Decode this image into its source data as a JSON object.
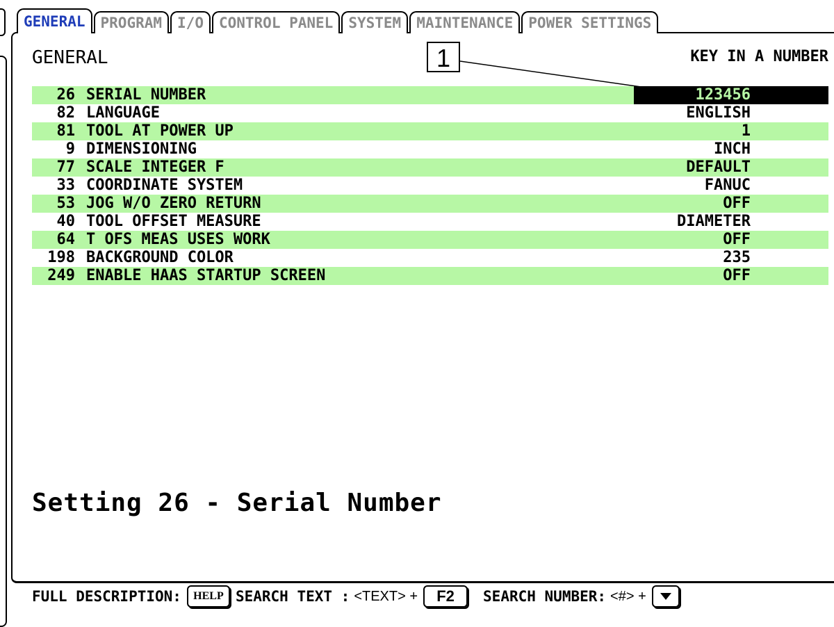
{
  "tabs": [
    {
      "label": "GENERAL",
      "active": true
    },
    {
      "label": "PROGRAM",
      "active": false
    },
    {
      "label": "I/O",
      "active": false
    },
    {
      "label": "CONTROL PANEL",
      "active": false
    },
    {
      "label": "SYSTEM",
      "active": false
    },
    {
      "label": "MAINTENANCE",
      "active": false
    },
    {
      "label": "POWER SETTINGS",
      "active": false
    }
  ],
  "page_title": "GENERAL",
  "prompt": "KEY IN A NUMBER",
  "callout": "1",
  "settings": [
    {
      "num": "26",
      "label": "SERIAL NUMBER",
      "value": "123456"
    },
    {
      "num": "82",
      "label": "LANGUAGE",
      "value": "ENGLISH"
    },
    {
      "num": "81",
      "label": "TOOL AT POWER UP",
      "value": "1"
    },
    {
      "num": "9",
      "label": "DIMENSIONING",
      "value": "INCH"
    },
    {
      "num": "77",
      "label": "SCALE INTEGER F",
      "value": "DEFAULT"
    },
    {
      "num": "33",
      "label": "COORDINATE SYSTEM",
      "value": "FANUC"
    },
    {
      "num": "53",
      "label": "JOG W/O ZERO RETURN",
      "value": "OFF"
    },
    {
      "num": "40",
      "label": "TOOL OFFSET MEASURE",
      "value": "DIAMETER"
    },
    {
      "num": "64",
      "label": "T OFS MEAS USES WORK",
      "value": "OFF"
    },
    {
      "num": "198",
      "label": "BACKGROUND COLOR",
      "value": "235"
    },
    {
      "num": "249",
      "label": "ENABLE HAAS STARTUP SCREEN",
      "value": "OFF"
    }
  ],
  "selected_setting": "26",
  "description": "Setting 26 - Serial Number",
  "footer": {
    "full_description_label": "FULL DESCRIPTION:",
    "help_key": "HELP",
    "search_text_label": "SEARCH TEXT :",
    "search_text_arg": "<TEXT> +",
    "f2_key": "F2",
    "search_number_label": "SEARCH NUMBER:",
    "search_number_arg": "<#> +",
    "down_key_icon": "down-arrow-icon"
  },
  "colors": {
    "row_shade": "#b7f7a5",
    "active_tab": "#1f3db8",
    "inactive_tab": "#8a8a8a",
    "selected_bg": "#000000"
  }
}
